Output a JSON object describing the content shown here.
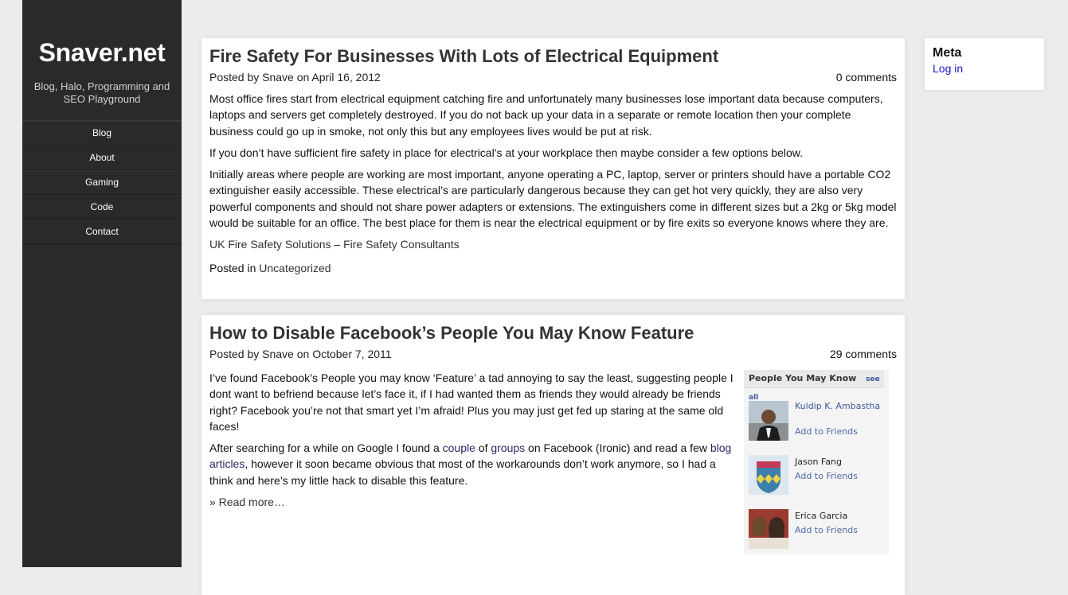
{
  "site": {
    "title": "Snaver.net",
    "tagline": "Blog, Halo, Programming and SEO Playground"
  },
  "nav": [
    "Blog",
    "About",
    "Gaming",
    "Code",
    "Contact"
  ],
  "posts": [
    {
      "title": "Fire Safety For Businesses With Lots of Electrical Equipment",
      "posted_by": "Posted by Snave on April 16, 2012",
      "comments": "0 comments",
      "paragraphs": [
        "Most office fires start from electrical equipment catching fire and unfortunately many businesses lose important data because computers, laptops and servers get completely destroyed. If you do not back up your data in a separate or remote location then your complete business could go up in smoke, not only this but any employees lives would be put at risk.",
        "If you don’t have sufficient fire safety in place for electrical’s at your workplace then maybe consider a few options below.",
        "Initially areas where people are working are most important, anyone operating a PC, laptop, server or printers should have a portable CO2 extinguisher easily accessible. These electrical’s are particularly dangerous because they can get hot very quickly, they are also very powerful components and should not share power adapters or extensions. The extinguishers come in different sizes but a 2kg or 5kg model would be suitable for an office. The best place for them is near the electrical equipment or by fire exits so everyone knows where they are."
      ],
      "link_text": "UK Fire Safety Solutions – Fire Safety Consultants",
      "posted_in_label": "Posted in",
      "category": "Uncategorized"
    },
    {
      "title": "How to Disable Facebook’s People You May Know Feature",
      "posted_by": "Posted by Snave on October 7, 2011",
      "comments": "29 comments",
      "paragraph1": "I’ve found Facebook’s People you may know ‘Feature’ a tad annoying to say the least, suggesting people I dont want to befriend because let’s face it, if I had wanted them as friends they would already be friends right? Facebook you’re not that smart yet I’m afraid! Plus you may just get fed up staring at the same old faces!",
      "p2_a": "After searching for a while on Google I found a ",
      "p2_link1": "couple",
      "p2_b": " of ",
      "p2_link2": "groups",
      "p2_c": " on Facebook (Ironic) and read a few ",
      "p2_link3": "blog articles",
      "p2_d": ", however it soon became obvious that most of the workarounds don’t work anymore, so I had a think and here’s my little hack to disable this feature.",
      "read_more": "» Read more…"
    }
  ],
  "fb_widget": {
    "header": "People You May Know",
    "see_all": "see all",
    "people": [
      {
        "name": "Kuldip K. Ambastha",
        "action": "Add to Friends"
      },
      {
        "name": "Jason Fang",
        "action": "Add to Friends"
      },
      {
        "name": "Erica Garcia",
        "action": "Add to Friends"
      }
    ]
  },
  "meta": {
    "title": "Meta",
    "login": "Log in"
  }
}
